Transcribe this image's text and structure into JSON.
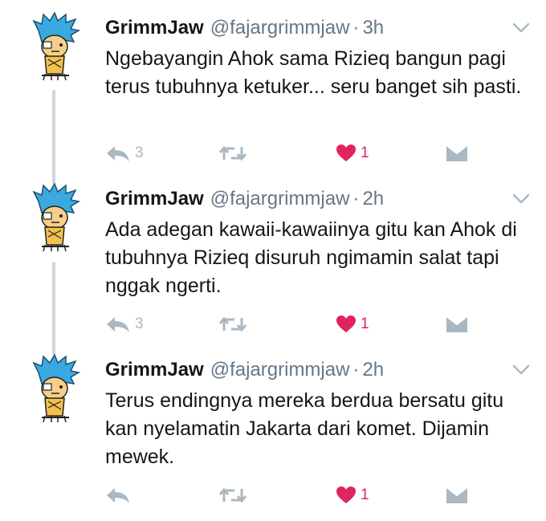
{
  "tweets": [
    {
      "name": "GrimmJaw",
      "handle": "@fajargrimmjaw",
      "separator": "·",
      "time": "3h",
      "text": "Ngebayangin Ahok sama Rizieq bangun pagi terus tubuhnya ketuker... seru banget sih pasti.",
      "replies": "3",
      "retweets": "",
      "likes": "1"
    },
    {
      "name": "GrimmJaw",
      "handle": "@fajargrimmjaw",
      "separator": "·",
      "time": "2h",
      "text": "Ada adegan kawaii-kawaiinya gitu kan Ahok di tubuhnya Rizieq disuruh ngimamin salat tapi nggak ngerti.",
      "replies": "3",
      "retweets": "",
      "likes": "1"
    },
    {
      "name": "GrimmJaw",
      "handle": "@fajargrimmjaw",
      "separator": "·",
      "time": "2h",
      "text": "Terus endingnya mereka berdua bersatu gitu kan nyelamatin Jakarta dari komet. Dijamin mewek.",
      "replies": "",
      "retweets": "",
      "likes": "1"
    }
  ],
  "icons": {
    "reply": "reply-icon",
    "retweet": "retweet-icon",
    "like": "heart-icon",
    "dm": "direct-message-icon",
    "caret": "chevron-down-icon"
  },
  "colors": {
    "text": "#14171a",
    "muted": "#657786",
    "icon": "#aab8c2",
    "like": "#e0245e",
    "thread_line": "#ccd6dd",
    "avatar_hair": "#3aa9e0"
  }
}
